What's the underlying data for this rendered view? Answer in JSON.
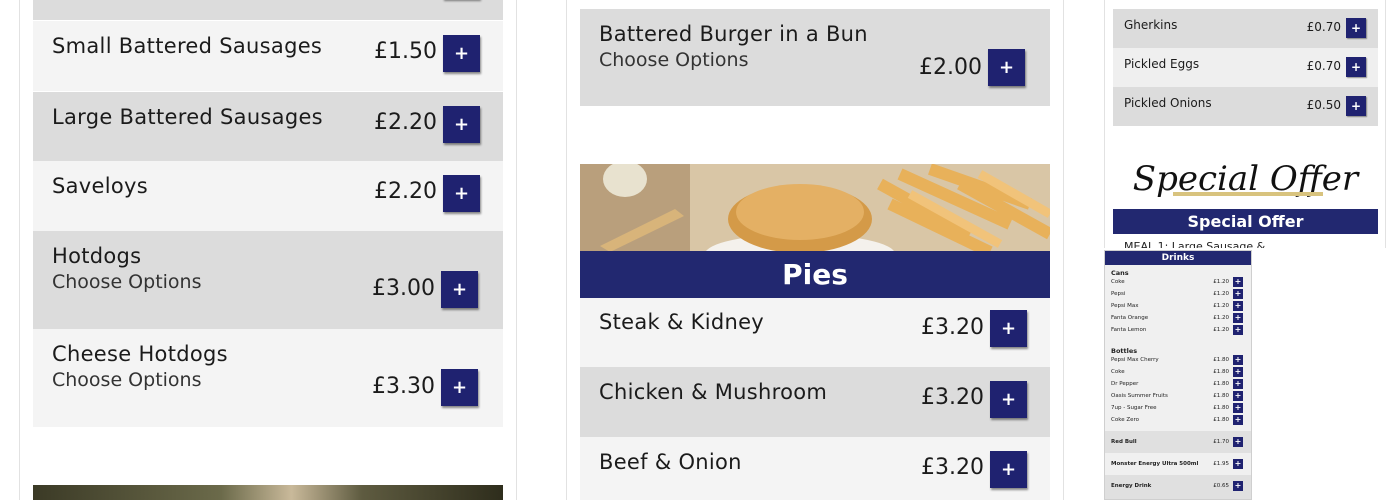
{
  "col1": {
    "items": [
      {
        "name": "Small Battered Sausages",
        "sub": "",
        "price": "£1.50"
      },
      {
        "name": "Large Battered Sausages",
        "sub": "",
        "price": "£2.20"
      },
      {
        "name": "Saveloys",
        "sub": "",
        "price": "£2.20"
      },
      {
        "name": "Hotdogs",
        "sub": "Choose Options",
        "price": "£3.00"
      },
      {
        "name": "Cheese Hotdogs",
        "sub": "Choose Options",
        "price": "£3.30"
      }
    ]
  },
  "col2": {
    "top_item": {
      "name": "Battered Burger in a Bun",
      "sub": "Choose Options",
      "price": "£2.00"
    },
    "pies_header": "Pies",
    "pies": [
      {
        "name": "Steak & Kidney",
        "price": "£3.20"
      },
      {
        "name": "Chicken & Mushroom",
        "price": "£3.20"
      },
      {
        "name": "Beef & Onion",
        "price": "£3.20"
      }
    ]
  },
  "col3": {
    "sides": [
      {
        "name": "Gherkins",
        "price": "£0.70"
      },
      {
        "name": "Pickled Eggs",
        "price": "£0.70"
      },
      {
        "name": "Pickled Onions",
        "price": "£0.50"
      }
    ],
    "offer_script": "Special Offer",
    "offer_header": "Special Offer",
    "offer_text": "MEAL 1: Large Sausage &"
  },
  "drinks": {
    "title": "Drinks",
    "cans_label": "Cans",
    "cans": [
      {
        "name": "Coke",
        "price": "£1.20"
      },
      {
        "name": "Pepsi",
        "price": "£1.20"
      },
      {
        "name": "Pepsi Max",
        "price": "£1.20"
      },
      {
        "name": "Fanta Orange",
        "price": "£1.20"
      },
      {
        "name": "Fanta Lemon",
        "price": "£1.20"
      }
    ],
    "bottles_label": "Bottles",
    "bottles": [
      {
        "name": "Pepsi Max Cherry",
        "price": "£1.80"
      },
      {
        "name": "Coke",
        "price": "£1.80"
      },
      {
        "name": "Dr Pepper",
        "price": "£1.80"
      },
      {
        "name": "Oasis Summer Fruits",
        "price": "£1.80"
      },
      {
        "name": "7up - Sugar Free",
        "price": "£1.80"
      },
      {
        "name": "Coke Zero",
        "price": "£1.80"
      }
    ],
    "others": [
      {
        "name": "Red Bull",
        "price": "£1.70"
      },
      {
        "name": "Monster Energy Ultra 500ml",
        "price": "£1.95"
      },
      {
        "name": "Energy Drink",
        "price": "£0.65"
      }
    ]
  },
  "icons": {
    "add": "plus-icon"
  },
  "colors": {
    "accent": "#1f2270",
    "row_dark": "#dcdcdc",
    "row_light": "#f4f4f4"
  }
}
